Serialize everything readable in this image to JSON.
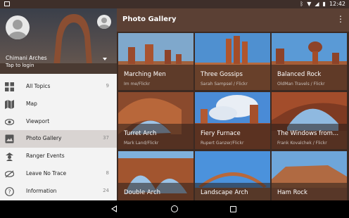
{
  "status_bar": {
    "time": "12:42",
    "icons": [
      "bluetooth-icon",
      "wifi-icon",
      "cell-signal-icon",
      "battery-icon"
    ]
  },
  "app_bar": {
    "title": "Photo Gallery",
    "overflow_icon": "more-vert-icon"
  },
  "drawer": {
    "account": {
      "name": "Chimani Arches",
      "subtitle": "Tap to login"
    },
    "items": [
      {
        "label": "All Topics",
        "count": "9",
        "icon": "grid-icon",
        "active": false
      },
      {
        "label": "Map",
        "count": "",
        "icon": "map-icon",
        "active": false
      },
      {
        "label": "Viewport",
        "count": "",
        "icon": "eye-icon",
        "active": false
      },
      {
        "label": "Photo Gallery",
        "count": "37",
        "icon": "photo-icon",
        "active": true
      },
      {
        "label": "Ranger Events",
        "count": "",
        "icon": "ranger-icon",
        "active": false
      },
      {
        "label": "Leave No Trace",
        "count": "8",
        "icon": "eye-slash-icon",
        "active": false
      },
      {
        "label": "Information",
        "count": "24",
        "icon": "help-icon",
        "active": false
      }
    ]
  },
  "gallery": {
    "tiles": [
      {
        "title": "Marching Men",
        "credit": "Im me/Flickr"
      },
      {
        "title": "Three Gossips",
        "credit": "Sarah Sampsel / Flickr"
      },
      {
        "title": "Balanced Rock",
        "credit": "OldMan Travels / Flickr"
      },
      {
        "title": "Turret Arch",
        "credit": "Mark Land/Flickr"
      },
      {
        "title": "Fiery Furnace",
        "credit": "Rupert Ganzer/Flickr"
      },
      {
        "title": "The Windows from...",
        "credit": "Frank Kovalchek / Flickr"
      },
      {
        "title": "Double Arch",
        "credit": ""
      },
      {
        "title": "Landscape Arch",
        "credit": ""
      },
      {
        "title": "Ham Rock",
        "credit": ""
      }
    ]
  },
  "colors": {
    "app_bar": "#5b4034",
    "gallery_bg": "#3c2a22",
    "drawer_bg": "#f3f3f3",
    "active_item": "#d9d4d2"
  }
}
